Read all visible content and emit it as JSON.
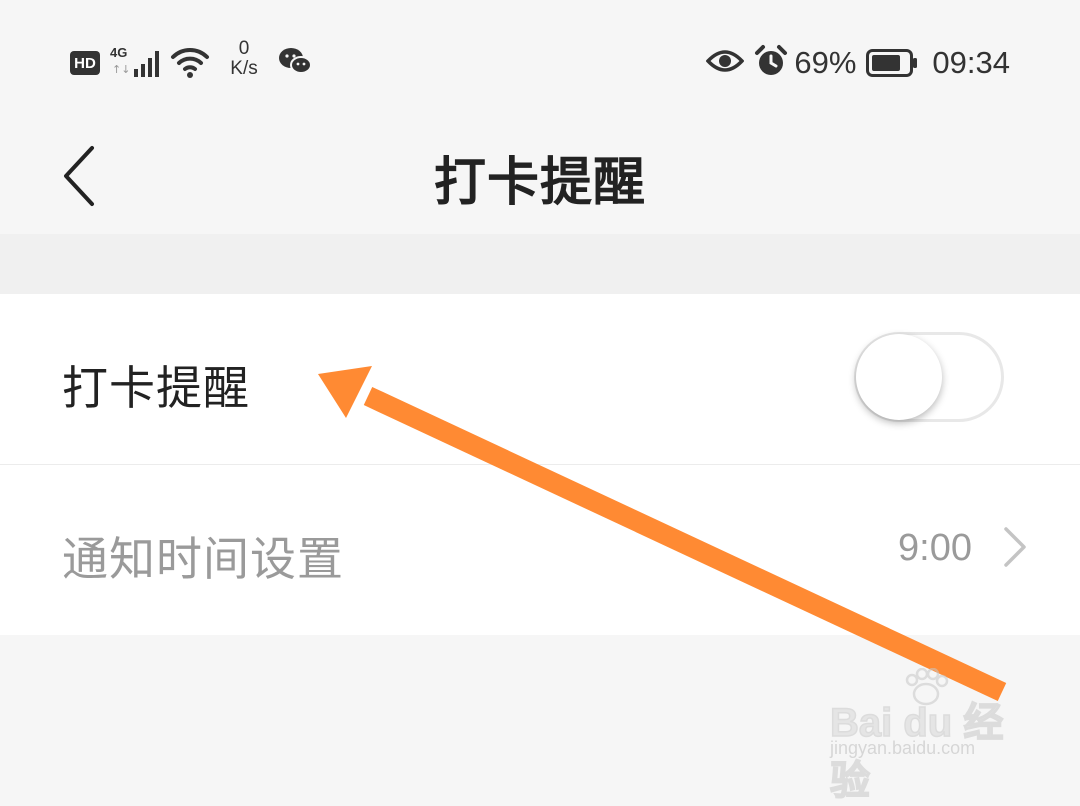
{
  "status_bar": {
    "hd_badge": "HD",
    "network_type": "4G",
    "net_speed_value": "0",
    "net_speed_unit": "K/s",
    "battery_percent": "69%",
    "time": "09:34",
    "icons": [
      "hd-icon",
      "signal-icon",
      "wifi-icon",
      "wechat-icon",
      "eye-icon",
      "alarm-icon",
      "battery-icon"
    ]
  },
  "header": {
    "title": "打卡提醒",
    "back_icon": "chevron-left-icon"
  },
  "settings": {
    "reminder_toggle": {
      "label": "打卡提醒",
      "state": "off"
    },
    "notify_time": {
      "label": "通知时间设置",
      "value": "9:00"
    }
  },
  "watermark": {
    "brand": "Bai du 经验",
    "url": "jingyan.baidu.com"
  },
  "annotation": {
    "arrow_color": "#ff8a33"
  }
}
